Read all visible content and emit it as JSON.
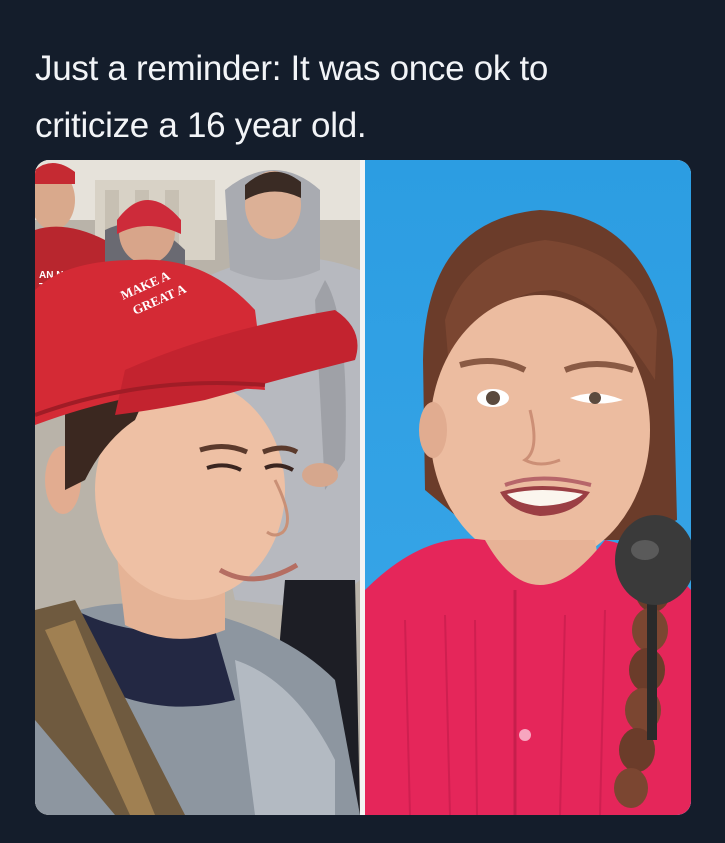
{
  "caption": {
    "line1": "Just a reminder: It was once ok to",
    "line2": "criticize a 16 year old."
  },
  "left_panel": {
    "hat_text_line1": "MAKE A",
    "hat_text_line2": "GREAT A"
  },
  "colors": {
    "background": "#141d2b",
    "caption_text": "#f2f4f7",
    "hat_red": "#d42a35",
    "right_backdrop": "#2a9ee6",
    "blouse": "#e5265a"
  }
}
